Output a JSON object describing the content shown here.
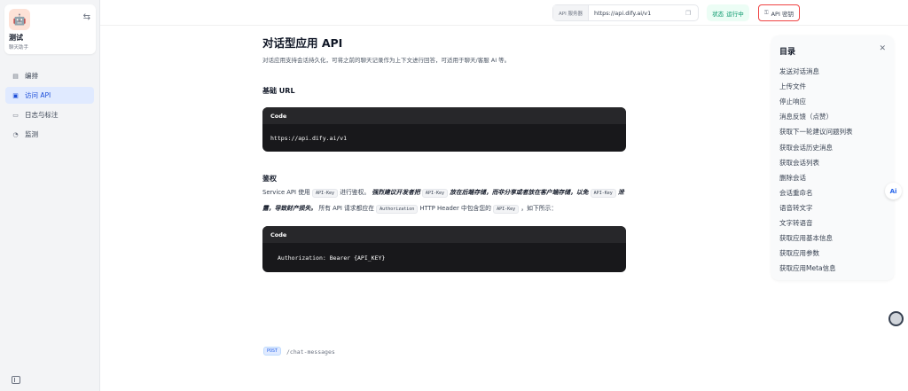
{
  "app": {
    "name": "测试",
    "type": "聊天助手",
    "icon": "robot-icon"
  },
  "nav": [
    {
      "label": "编排",
      "icon": "edit-icon"
    },
    {
      "label": "访问 API",
      "icon": "api-icon",
      "active": true
    },
    {
      "label": "日志与标注",
      "icon": "log-icon"
    },
    {
      "label": "监测",
      "icon": "monitor-icon"
    }
  ],
  "topbar": {
    "api_server_label": "API 服务器",
    "api_server_url": "https://api.dify.ai/v1",
    "status_label": "状态",
    "status_value": "运行中",
    "api_key_label": "API 密钥"
  },
  "doc": {
    "title": "对话型应用 API",
    "intro": "对话应用支持会话持久化，可将之前的聊天记录作为上下文进行回答，可适用于聊天/客服 AI 等。",
    "base_url_heading": "基础 URL",
    "code_label": "Code",
    "base_url_code": "https://api.dify.ai/v1",
    "auth_heading": "鉴权",
    "auth_p1": "Service API 使用",
    "auth_chip1": "API-Key",
    "auth_p2": "进行鉴权。",
    "auth_bold1": "强烈建议开发者把",
    "auth_chip2": "API-Key",
    "auth_bold2": "放在后端存储，而非分享或者放在客户端存储，以免",
    "auth_chip3": "API-Key",
    "auth_bold3": "泄露，导致财产损失。",
    "auth_p3": "所有 API 请求都应在",
    "auth_chip4": "Authorization",
    "auth_p4": "HTTP Header 中包含您的",
    "auth_chip5": "API-Key",
    "auth_p5": "，如下所示：",
    "auth_code": "Authorization: Bearer {API_KEY}",
    "method": "POST",
    "endpoint": "/chat-messages"
  },
  "toc": {
    "title": "目录",
    "items": [
      "发送对话消息",
      "上传文件",
      "停止响应",
      "消息反馈（点赞）",
      "获取下一轮建议问题列表",
      "获取会话历史消息",
      "获取会话列表",
      "删除会话",
      "会话重命名",
      "语音转文字",
      "文字转语音",
      "获取应用基本信息",
      "获取应用参数",
      "获取应用Meta信息"
    ]
  },
  "colors": {
    "accent": "#1d4ed8",
    "status_green": "#059669",
    "highlight_border": "#ef4444",
    "code_bg": "#18181b"
  }
}
